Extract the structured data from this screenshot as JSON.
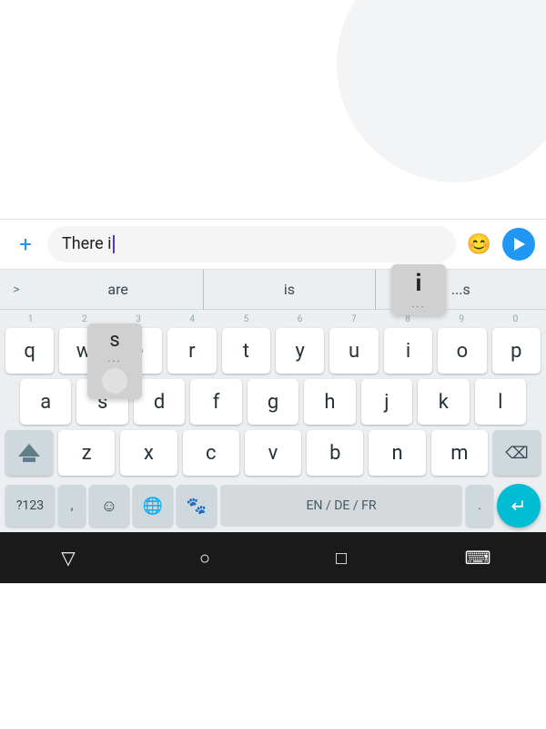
{
  "top_area": {
    "decoration": "circle"
  },
  "input_bar": {
    "plus_label": "+",
    "text_value": "There i",
    "emoji_icon": "😊",
    "send_label": "send"
  },
  "suggestions": {
    "arrow": ">",
    "items": [
      "are",
      "is",
      "...s"
    ]
  },
  "keyboard": {
    "numbers": [
      "1",
      "2",
      "3",
      "4",
      "5",
      "6",
      "7",
      "8",
      "9",
      "0"
    ],
    "row1": [
      "q",
      "w",
      "e",
      "r",
      "t",
      "y",
      "u",
      "i",
      "o",
      "p"
    ],
    "row2": [
      "a",
      "s",
      "d",
      "f",
      "g",
      "h",
      "j",
      "k",
      "l"
    ],
    "row3": [
      "z",
      "x",
      "c",
      "v",
      "b",
      "n",
      "m"
    ],
    "bottom": {
      "num_label": "?123",
      "comma_label": ",",
      "emoji_label": "☺",
      "globe_label": "🌐",
      "paw_label": "🐾",
      "lang_label": "EN / DE / FR",
      "period_label": ".",
      "enter_label": "↵"
    },
    "popup_i": {
      "char": "i",
      "dots": "..."
    },
    "popup_s": {
      "char": "s",
      "dots": "..."
    }
  },
  "nav_bar": {
    "back_icon": "▽",
    "home_icon": "○",
    "recents_icon": "□",
    "keyboard_icon": "⌨"
  }
}
